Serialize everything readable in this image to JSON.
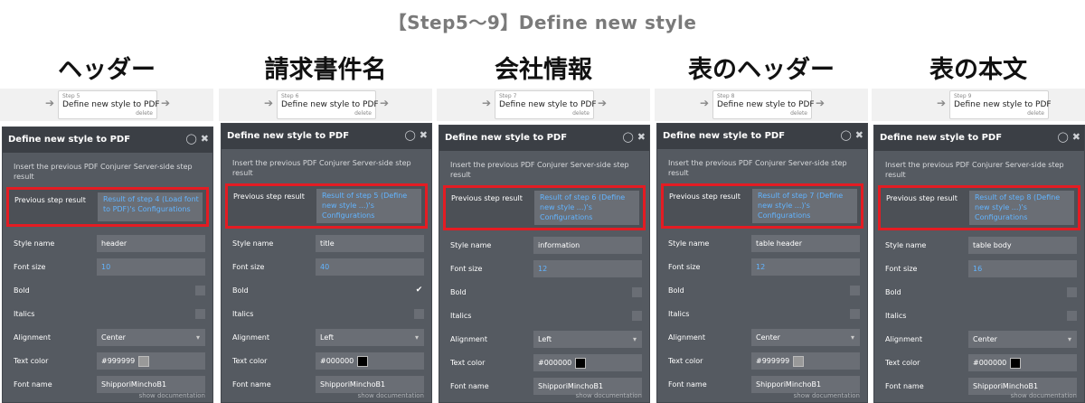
{
  "title": "【Step5〜9】Define new  style",
  "columns": [
    {
      "heading": "ヘッダー",
      "step": {
        "num": "Step 5",
        "label": "Define new style to PDF",
        "delete": "delete"
      },
      "panel": {
        "title": "Define new style to PDF",
        "description": "Insert the previous PDF Conjurer Server-side step result",
        "previous_label": "Previous step result",
        "previous_value": "Result of step 4 (Load font to PDF)'s Configurations",
        "style_name_label": "Style name",
        "style_name": "header",
        "font_size_label": "Font size",
        "font_size": "10",
        "bold_label": "Bold",
        "bold": false,
        "italics_label": "Italics",
        "alignment_label": "Alignment",
        "alignment": "Center",
        "text_color_label": "Text color",
        "text_color": "#999999",
        "swatch": "#999999",
        "font_name_label": "Font name",
        "font_name": "ShipporiMinchoB1",
        "show_doc": "show documentation"
      }
    },
    {
      "heading": "請求書件名",
      "step": {
        "num": "Step 6",
        "label": "Define new style to PDF",
        "delete": "delete"
      },
      "panel": {
        "title": "Define new style to PDF",
        "description": "Insert the previous PDF Conjurer Server-side step result",
        "previous_label": "Previous step result",
        "previous_value": "Result of step 5 (Define new style ...)'s Configurations",
        "style_name_label": "Style name",
        "style_name": "title",
        "font_size_label": "Font size",
        "font_size": "40",
        "bold_label": "Bold",
        "bold": true,
        "italics_label": "Italics",
        "alignment_label": "Alignment",
        "alignment": "Left",
        "text_color_label": "Text color",
        "text_color": "#000000",
        "swatch": "#000000",
        "font_name_label": "Font name",
        "font_name": "ShipporiMinchoB1",
        "show_doc": "show documentation"
      }
    },
    {
      "heading": "会社情報",
      "step": {
        "num": "Step 7",
        "label": "Define new style to PDF",
        "delete": "delete"
      },
      "panel": {
        "title": "Define new style to PDF",
        "description": "Insert the previous PDF Conjurer Server-side step result",
        "previous_label": "Previous step result",
        "previous_value": "Result of step 6 (Define new style ...)'s Configurations",
        "style_name_label": "Style name",
        "style_name": "information",
        "font_size_label": "Font size",
        "font_size": "12",
        "bold_label": "Bold",
        "bold": false,
        "italics_label": "Italics",
        "alignment_label": "Alignment",
        "alignment": "Left",
        "text_color_label": "Text color",
        "text_color": "#000000",
        "swatch": "#000000",
        "font_name_label": "Font name",
        "font_name": "ShipporiMinchoB1",
        "show_doc": "show documentation"
      }
    },
    {
      "heading": "表のヘッダー",
      "step": {
        "num": "Step 8",
        "label": "Define new style to PDF",
        "delete": "delete"
      },
      "panel": {
        "title": "Define new style to PDF",
        "description": "Insert the previous PDF Conjurer Server-side step result",
        "previous_label": "Previous step result",
        "previous_value": "Result of step 7 (Define new style ...)'s Configurations",
        "style_name_label": "Style name",
        "style_name": "table header",
        "font_size_label": "Font size",
        "font_size": "12",
        "bold_label": "Bold",
        "bold": false,
        "italics_label": "Italics",
        "alignment_label": "Alignment",
        "alignment": "Center",
        "text_color_label": "Text color",
        "text_color": "#999999",
        "swatch": "#999999",
        "font_name_label": "Font name",
        "font_name": "ShipporiMinchoB1",
        "show_doc": "show documentation"
      }
    },
    {
      "heading": "表の本文",
      "step": {
        "num": "Step 9",
        "label": "Define new style to PDF",
        "delete": "delete"
      },
      "panel": {
        "title": "Define new style to PDF",
        "description": "Insert the previous PDF Conjurer Server-side step result",
        "previous_label": "Previous step result",
        "previous_value": "Result of step 8 (Define new style ...)'s Configurations",
        "style_name_label": "Style name",
        "style_name": "table body",
        "font_size_label": "Font size",
        "font_size": "16",
        "bold_label": "Bold",
        "bold": false,
        "italics_label": "Italics",
        "alignment_label": "Alignment",
        "alignment": "Center",
        "text_color_label": "Text color",
        "text_color": "#000000",
        "swatch": "#000000",
        "font_name_label": "Font name",
        "font_name": "ShipporiMinchoB1",
        "show_doc": "show documentation"
      }
    }
  ],
  "icons": {
    "comment": "comment-icon",
    "close": "close-icon",
    "arrow": "arrow-right-icon",
    "dropdown": "chevron-down-icon",
    "check": "check-icon"
  },
  "colors": {
    "panel_bg": "#555a61",
    "header_bg": "#3b3f45",
    "highlight": "#e41c23",
    "link_blue": "#62b4ff"
  }
}
